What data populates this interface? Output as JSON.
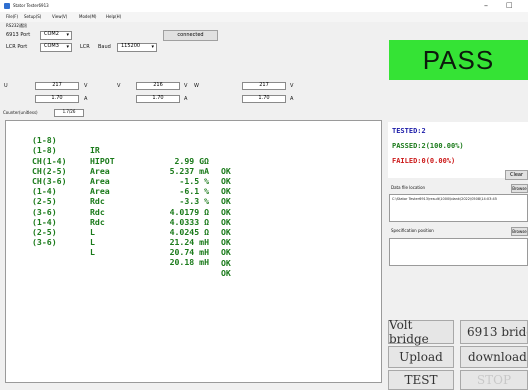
{
  "window": {
    "title": "Stator Tester6913",
    "minimize_glyph": "–",
    "extra_glyph": "□"
  },
  "menu": [
    {
      "label": "File(F)"
    },
    {
      "label": "Setup(S)"
    },
    {
      "label": "View(V)"
    },
    {
      "label": "Mode(M)"
    },
    {
      "label": "Help(H)"
    }
  ],
  "conn": {
    "group_label": "RS232通訊",
    "port_label": "6913 Port",
    "port_value": "COM2",
    "lcr_port_label": "LCR Port",
    "lcr_port_value": "COM3",
    "lcr_label": "LCR",
    "baud_label": "Baud",
    "baud_value": "115200",
    "connect_button": "connected"
  },
  "meas": {
    "u_label": "U",
    "v_label": "V",
    "w_label": "W",
    "volt_unit": "V",
    "amp_unit": "A",
    "u_voltage": "217",
    "u_current": "1.70",
    "v_voltage": "216",
    "v_current": "1.70",
    "w_voltage": "217",
    "w_current": "1.70"
  },
  "counter": {
    "label": "Counter(unitless)",
    "value": "1.7/26"
  },
  "verdict": {
    "text": "PASS",
    "color": "#35e335"
  },
  "results": [
    {
      "pos": "(1-8)",
      "name": "IR",
      "value": "2.99 GΩ",
      "status": "OK"
    },
    {
      "pos": "(1-8)",
      "name": "HIPOT",
      "value": "5.237 mA",
      "status": "OK"
    },
    {
      "pos": "CH(1-4)",
      "name": "Area",
      "value": "-1.5 %",
      "status": "OK"
    },
    {
      "pos": "CH(2-5)",
      "name": "Area",
      "value": "-6.1 %",
      "status": "OK"
    },
    {
      "pos": "CH(3-6)",
      "name": "Area",
      "value": "-3.3 %",
      "status": "OK"
    },
    {
      "pos": "(1-4)",
      "name": "Rdc",
      "value": "4.0179 Ω",
      "status": "OK"
    },
    {
      "pos": "(2-5)",
      "name": "Rdc",
      "value": "4.0333 Ω",
      "status": "OK"
    },
    {
      "pos": "(3-6)",
      "name": "Rdc",
      "value": "4.0245 Ω",
      "status": "OK"
    },
    {
      "pos": "(1-4)",
      "name": "L",
      "value": "21.24 mH",
      "status": "OK"
    },
    {
      "pos": "(2-5)",
      "name": "L",
      "value": "20.74 mH",
      "status": "OK"
    },
    {
      "pos": "(3-6)",
      "name": "L",
      "value": "20.18 mH",
      "status": "OK"
    }
  ],
  "stats": {
    "tested": "TESTED:2",
    "passed": "PASSED:2(100.00%)",
    "failed": "FAILED:0(0.00%)"
  },
  "clear_button": "Clear",
  "data_file": {
    "label": "Data file location",
    "browse": "Browse",
    "path": "C:\\Stator Tester6913\\result\\1000\\blank\\2022\\0508\\14:03:45"
  },
  "spec": {
    "label": "Specification position",
    "browse": "Browse"
  },
  "buttons": {
    "volt_bridge": "Volt bridge",
    "bridge_6913": "6913 bridge",
    "upload": "Upload",
    "download": "download",
    "test": "TEST",
    "stop": "STOP"
  },
  "colors": {
    "result_text": "#1a7a1a",
    "stats_blue": "#1a1aa8",
    "stats_green": "#1a7a1a",
    "stats_red": "#cc1a1a"
  }
}
